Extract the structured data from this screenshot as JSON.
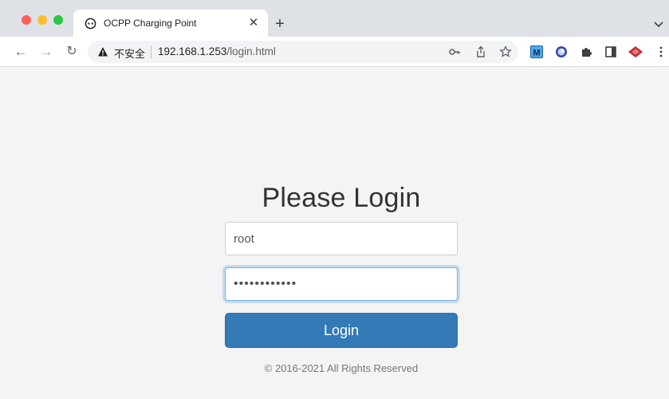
{
  "browser": {
    "tab": {
      "title": "OCPP Charging Point",
      "close_glyph": "✕"
    },
    "new_tab_glyph": "+",
    "address_bar": {
      "security_label": "不安全",
      "url_host": "192.168.1.253",
      "url_path": "/login.html"
    },
    "icons": {
      "back": "←",
      "forward": "→",
      "reload": "↻"
    }
  },
  "login": {
    "heading": "Please Login",
    "username_value": "root",
    "password_value": "••••••••••••",
    "button_label": "Login",
    "footer": "© 2016-2021 All Rights Reserved"
  },
  "colors": {
    "primary_button": "#337ab7",
    "focus_ring": "#66afe9"
  }
}
